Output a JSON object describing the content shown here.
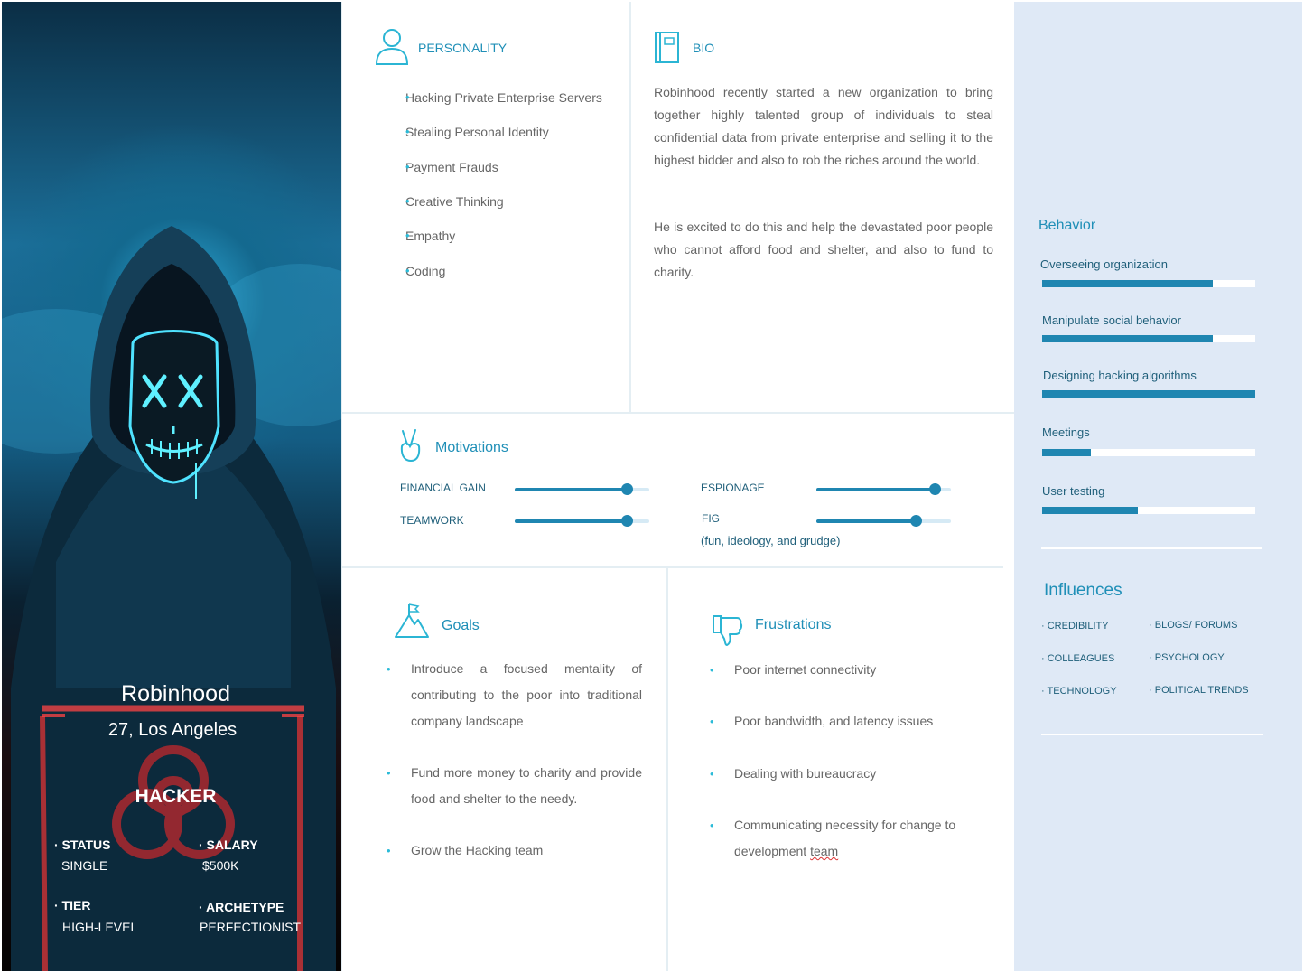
{
  "profile": {
    "name": "Robinhood",
    "age_location": "27, Los Angeles",
    "role": "HACKER",
    "stats": [
      {
        "label": "· STATUS",
        "value": "SINGLE"
      },
      {
        "label": "· SALARY",
        "value": "$500K"
      },
      {
        "label": "· TIER",
        "value": "HIGH-LEVEL"
      },
      {
        "label": "· ARCHETYPE",
        "value": "PERFECTIONIST"
      }
    ]
  },
  "personality": {
    "title": "PERSONALITY",
    "icon": "person-icon",
    "items": [
      "Hacking Private Enterprise Servers",
      "Stealing Personal Identity",
      "Payment Frauds",
      "Creative Thinking",
      "Empathy",
      "Coding"
    ]
  },
  "bio": {
    "title": "BIO",
    "icon": "book-icon",
    "paragraphs": [
      "Robinhood recently started a new organization to bring together highly talented group of individuals to steal confidential data from private enterprise and selling it to the highest bidder and also to rob the riches around the world.",
      "He is excited to do this and help the devastated poor people who cannot afford food and shelter, and also to fund to charity."
    ]
  },
  "motivations": {
    "title": "Motivations",
    "icon": "peace-hand-icon",
    "items": [
      {
        "label": "FINANCIAL GAIN",
        "value": 0.83
      },
      {
        "label": "TEAMWORK",
        "value": 0.83
      },
      {
        "label": "ESPIONAGE",
        "value": 0.88
      },
      {
        "label": "FIG",
        "value": 0.74,
        "note": "(fun, ideology, and grudge)"
      }
    ]
  },
  "goals": {
    "title": "Goals",
    "icon": "mountain-flag-icon",
    "items": [
      "Introduce a focused mentality of contributing to the poor into traditional company landscape",
      "Fund more money to charity and provide food and shelter to the needy.",
      "Grow the Hacking team"
    ]
  },
  "frustrations": {
    "title": "Frustrations",
    "icon": "thumbs-down-icon",
    "items": [
      "Poor internet connectivity",
      "Poor bandwidth, and latency issues",
      "Dealing with bureaucracy",
      "Communicating necessity for change to development team"
    ]
  },
  "behavior": {
    "title": "Behavior",
    "items": [
      {
        "label": "Overseeing organization",
        "value": 0.8
      },
      {
        "label": "Manipulate social behavior",
        "value": 0.8
      },
      {
        "label": "Designing hacking algorithms",
        "value": 1.0
      },
      {
        "label": "Meetings",
        "value": 0.23
      },
      {
        "label": "User testing",
        "value": 0.45
      }
    ]
  },
  "influences": {
    "title": "Influences",
    "items": [
      "CREDIBILITY",
      "BLOGS/ FORUMS",
      "COLLEAGUES",
      "PSYCHOLOGY",
      "TECHNOLOGY",
      "POLITICAL TRENDS"
    ]
  },
  "colors": {
    "accent": "#1f8fb7",
    "bar": "#1f86b1",
    "sidebar_bg": "#dfe9f6",
    "bullet": "#2bbbd8"
  }
}
